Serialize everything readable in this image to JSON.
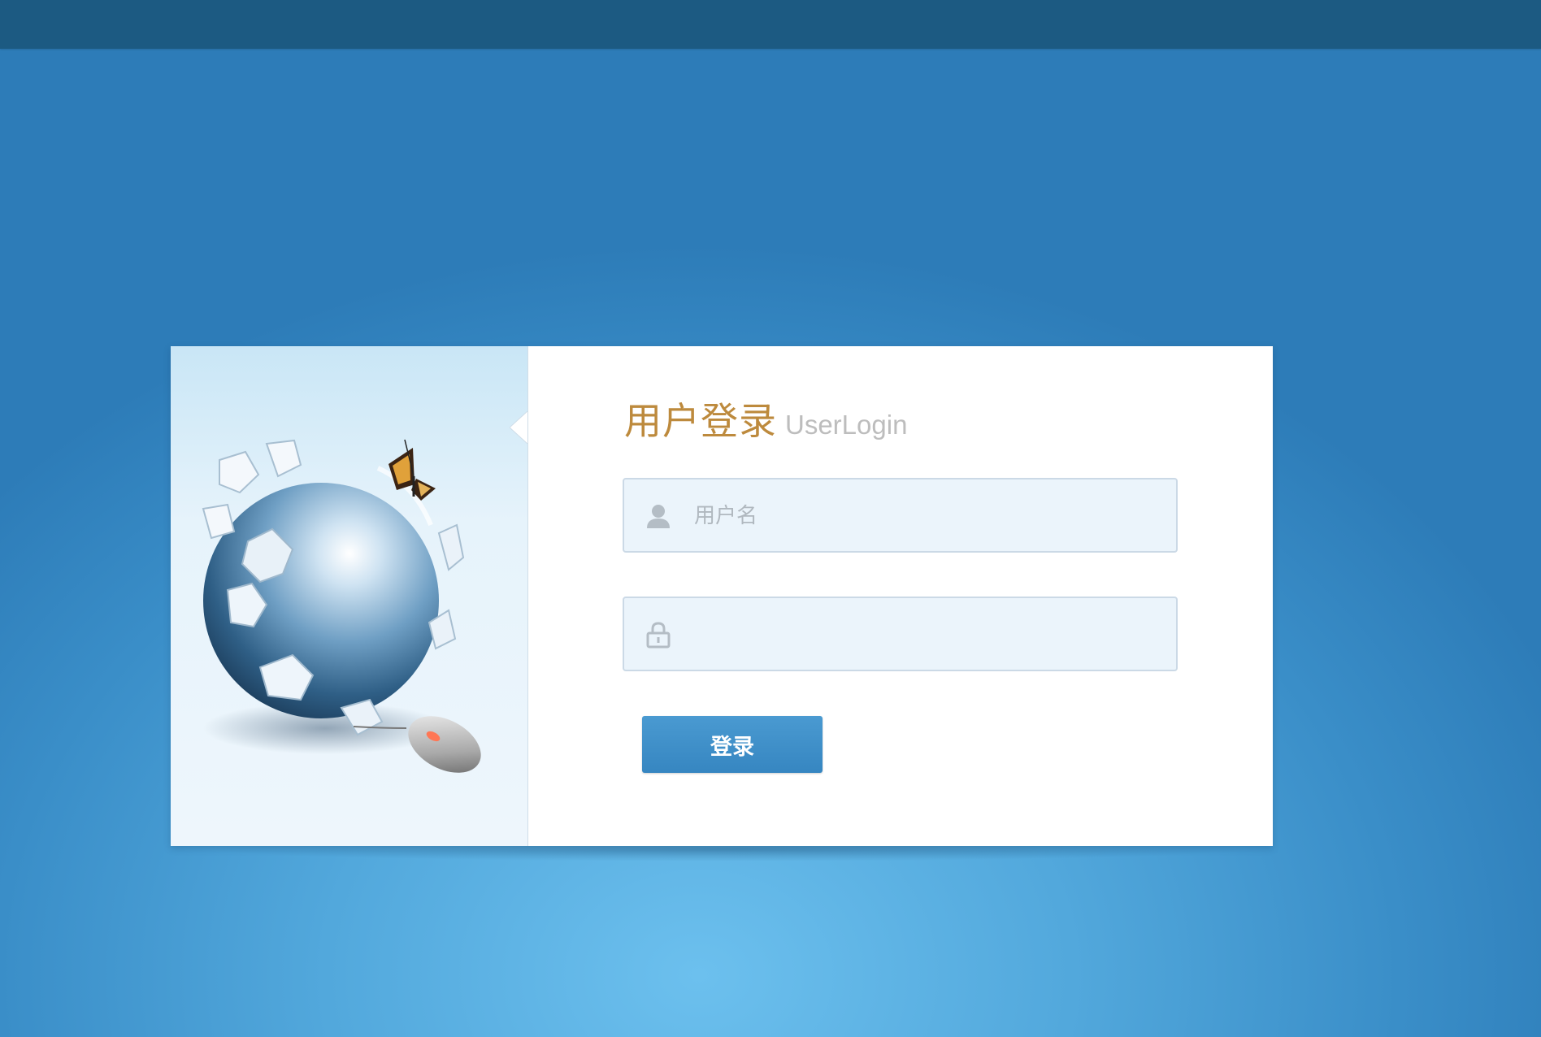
{
  "login": {
    "title_cn": "用户登录",
    "title_en": "UserLogin",
    "username_placeholder": "用户名",
    "password_placeholder": "",
    "submit_label": "登录"
  },
  "icons": {
    "username": "user-icon",
    "password": "lock-icon"
  },
  "colors": {
    "topbar": "#1c5a82",
    "title_cn": "#bd8a3d",
    "title_en": "#bdbdbd",
    "button": "#3a8ac4",
    "field_bg": "#ebf4fb"
  }
}
